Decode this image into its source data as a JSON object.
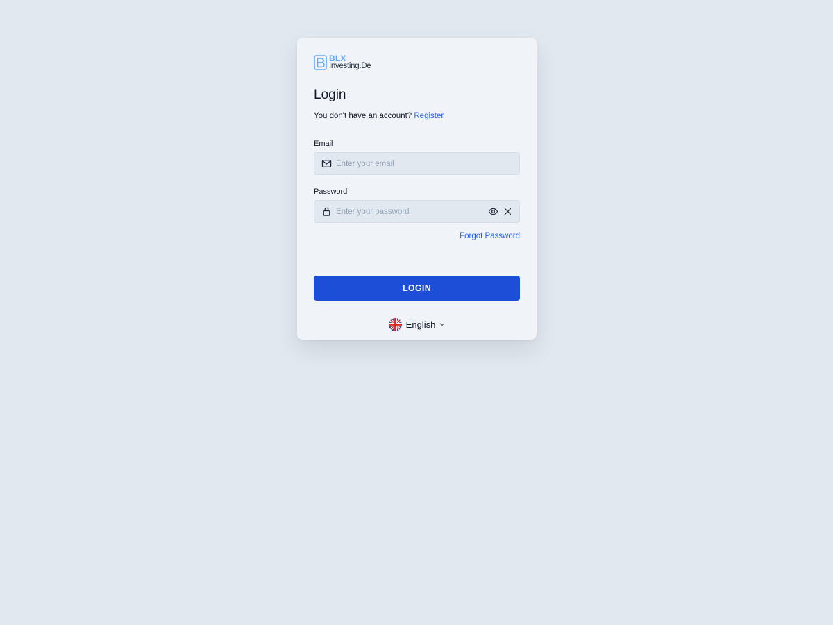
{
  "brand": {
    "name_top": "BLX",
    "name_bottom": "Investing.De",
    "accent_color": "#60a5fa",
    "icon": "logo-b-icon"
  },
  "login": {
    "title": "Login",
    "no_account_text": "You don't have an account?",
    "register_link": "Register",
    "email": {
      "label": "Email",
      "placeholder": "Enter your email",
      "value": "",
      "icon": "mail-icon"
    },
    "password": {
      "label": "Password",
      "placeholder": "Enter your password",
      "value": "",
      "icon": "lock-icon",
      "toggle_icon": "eye-icon",
      "clear_icon": "close-icon"
    },
    "forgot_password": "Forgot Password",
    "submit_label": "LOGIN",
    "submit_color": "#1d4ed8"
  },
  "language": {
    "selected": "English",
    "flag_icon": "uk-flag-icon",
    "dropdown_icon": "chevron-down-icon"
  }
}
